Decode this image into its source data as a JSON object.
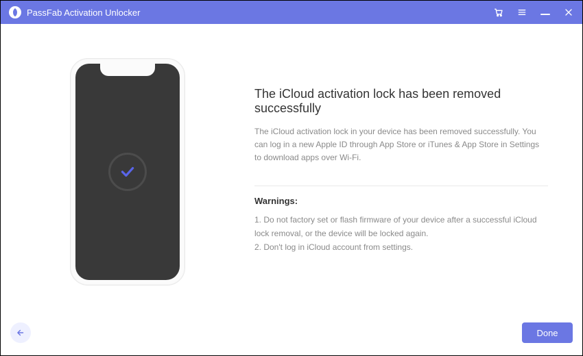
{
  "app": {
    "title": "PassFab Activation Unlocker"
  },
  "colors": {
    "accent": "#6b77e3",
    "phone_screen": "#393939",
    "check_stroke": "#5965e8"
  },
  "content": {
    "heading": "The iCloud activation lock has been removed successfully",
    "description": "The iCloud activation lock in your device has been removed successfully. You can log in a new Apple ID through App Store or iTunes & App Store in Settings to download apps over Wi-Fi.",
    "warnings_title": "Warnings:",
    "warnings": [
      "1. Do not factory set or flash firmware of your device after a successful iCloud lock removal, or the device will be locked again.",
      "2. Don't log in iCloud account from settings."
    ]
  },
  "footer": {
    "done_label": "Done"
  }
}
